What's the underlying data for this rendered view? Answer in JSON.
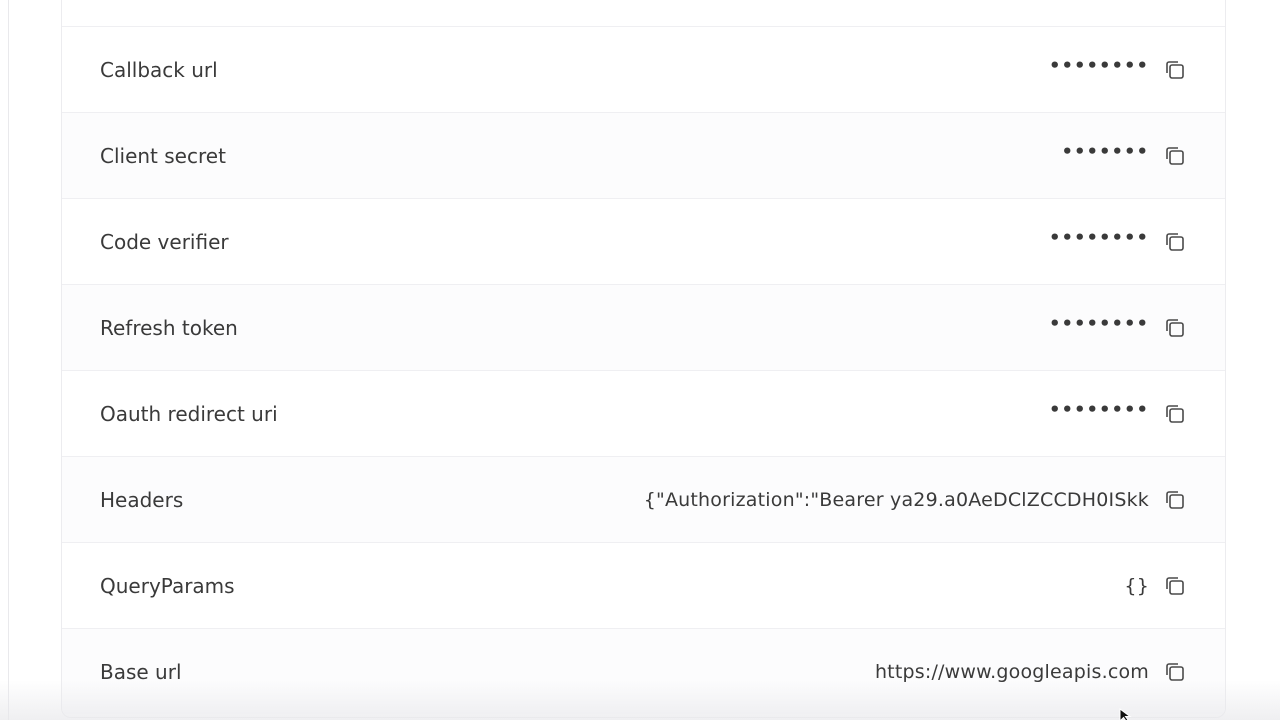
{
  "rows": [
    {
      "label": "Callback url",
      "value": "••••••••",
      "masked": true,
      "copy_icon": "copy-icon"
    },
    {
      "label": "Client secret",
      "value": "•••••••",
      "masked": true,
      "copy_icon": "copy-icon"
    },
    {
      "label": "Code verifier",
      "value": "••••••••",
      "masked": true,
      "copy_icon": "copy-icon"
    },
    {
      "label": "Refresh token",
      "value": "••••••••",
      "masked": true,
      "copy_icon": "copy-icon"
    },
    {
      "label": "Oauth redirect uri",
      "value": "••••••••",
      "masked": true,
      "copy_icon": "copy-icon"
    },
    {
      "label": "Headers",
      "value": "{\"Authorization\":\"Bearer ya29.a0AeDClZCCDH0ISkk",
      "masked": false,
      "copy_icon": "copy-icon"
    },
    {
      "label": "QueryParams",
      "value": "{}",
      "masked": false,
      "copy_icon": "copy-icon"
    },
    {
      "label": "Base url",
      "value": "https://www.googleapis.com",
      "masked": false,
      "copy_icon": "copy-icon"
    }
  ],
  "colors": {
    "text": "#3a3a3a",
    "border": "#efeff2",
    "icon": "#4a4a4a"
  }
}
